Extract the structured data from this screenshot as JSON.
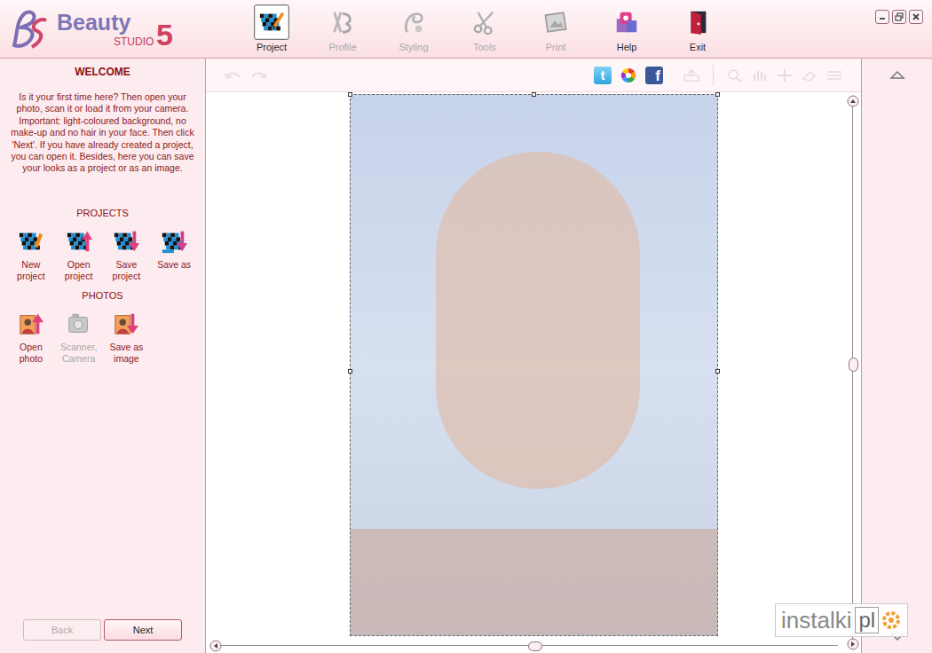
{
  "logo": {
    "name": "Beauty",
    "product": "STUDIO",
    "version": "5"
  },
  "toolbar": [
    {
      "label": "Project",
      "selected": true,
      "disabled": false
    },
    {
      "label": "Profile",
      "selected": false,
      "disabled": true
    },
    {
      "label": "Styling",
      "selected": false,
      "disabled": true
    },
    {
      "label": "Tools",
      "selected": false,
      "disabled": true
    },
    {
      "label": "Print",
      "selected": false,
      "disabled": true
    },
    {
      "label": "Help",
      "selected": false,
      "disabled": false
    },
    {
      "label": "Exit",
      "selected": false,
      "disabled": false
    }
  ],
  "panel": {
    "title": "WELCOME",
    "intro": "Is it your first time here? Then open your photo, scan it or load it from your camera. Important: light-coloured background, no make-up and no hair in your face. Then click 'Next'. If you have already created a project, you can open it. Besides, here you can save your looks as a project or as an image.",
    "sections": [
      {
        "title": "PROJECTS",
        "items": [
          {
            "label": "New project",
            "disabled": false
          },
          {
            "label": "Open project",
            "disabled": false
          },
          {
            "label": "Save project",
            "disabled": false
          },
          {
            "label": "Save as",
            "disabled": false
          }
        ]
      },
      {
        "title": "PHOTOS",
        "items": [
          {
            "label": "Open photo",
            "disabled": false
          },
          {
            "label": "Scanner, Camera",
            "disabled": true
          },
          {
            "label": "Save as image",
            "disabled": false
          }
        ]
      }
    ]
  },
  "nav_buttons": [
    {
      "label": "Back",
      "disabled": true
    },
    {
      "label": "Next",
      "disabled": false
    }
  ],
  "share": {
    "twitter": "t",
    "facebook": "f"
  },
  "watermark": {
    "name": "instalki",
    "domain": "pl"
  }
}
